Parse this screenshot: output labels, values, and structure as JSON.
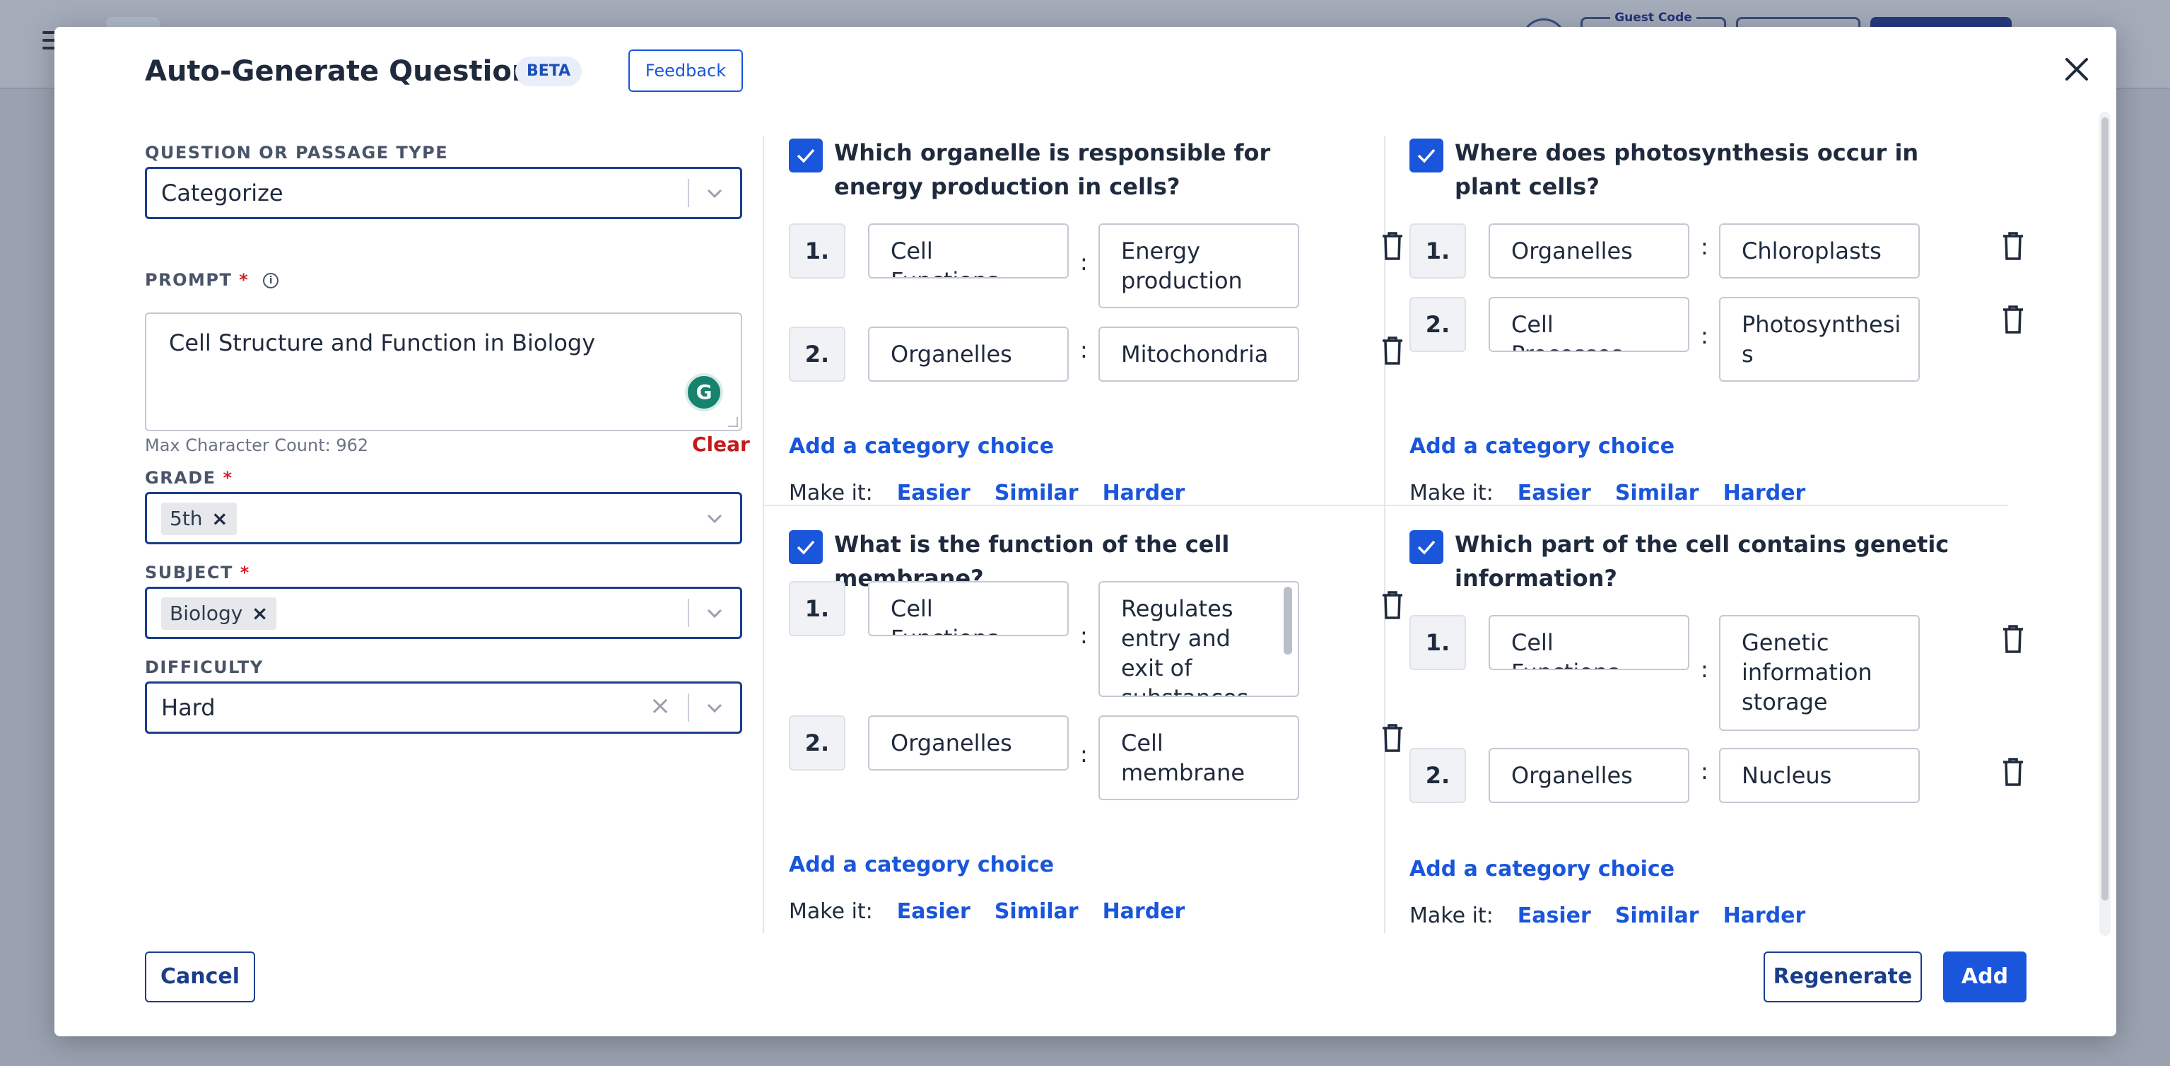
{
  "background": {
    "guest_code_label": "Guest Code"
  },
  "modal": {
    "title": "Auto-Generate Questions",
    "beta_badge": "BETA",
    "feedback_label": "Feedback",
    "close_icon": "close-icon"
  },
  "form": {
    "type_label": "QUESTION OR PASSAGE TYPE",
    "type_value": "Categorize",
    "prompt_label": "PROMPT",
    "prompt_value": "Cell Structure and Function in Biology",
    "max_count": "Max Character Count: 962",
    "clear_label": "Clear",
    "grade_label": "GRADE",
    "grade_value": "5th",
    "subject_label": "SUBJECT",
    "subject_value": "Biology",
    "difficulty_label": "DIFFICULTY",
    "difficulty_value": "Hard",
    "required_mark": "*"
  },
  "questions": [
    {
      "title": "Which organelle is responsible for energy production in cells?",
      "rows": [
        {
          "num": "1.",
          "category": "Cell Functions",
          "value": "Energy production"
        },
        {
          "num": "2.",
          "category": "Organelles",
          "value": "Mitochondria"
        }
      ]
    },
    {
      "title": "Where does photosynthesis occur in plant cells?",
      "rows": [
        {
          "num": "1.",
          "category": "Organelles",
          "value": "Chloroplasts"
        },
        {
          "num": "2.",
          "category": "Cell Processes",
          "value": "Photosynthesi s"
        }
      ]
    },
    {
      "title": "What is the function of the cell membrane?",
      "rows": [
        {
          "num": "1.",
          "category": "Cell Functions",
          "value": "Regulates entry and exit of substances"
        },
        {
          "num": "2.",
          "category": "Organelles",
          "value": "Cell membrane"
        }
      ]
    },
    {
      "title": "Which part of the cell contains genetic information?",
      "rows": [
        {
          "num": "1.",
          "category": "Cell Functions",
          "value": "Genetic information storage"
        },
        {
          "num": "2.",
          "category": "Organelles",
          "value": "Nucleus"
        }
      ]
    }
  ],
  "card_actions": {
    "add_choice": "Add a category choice",
    "make_it": "Make it:",
    "easier": "Easier",
    "similar": "Similar",
    "harder": "Harder",
    "separator": ":"
  },
  "footer": {
    "cancel": "Cancel",
    "regenerate": "Regenerate",
    "add": "Add"
  },
  "colors": {
    "accent": "#1a56db",
    "danger": "#c41a1a",
    "navy": "#1a3e8c"
  }
}
